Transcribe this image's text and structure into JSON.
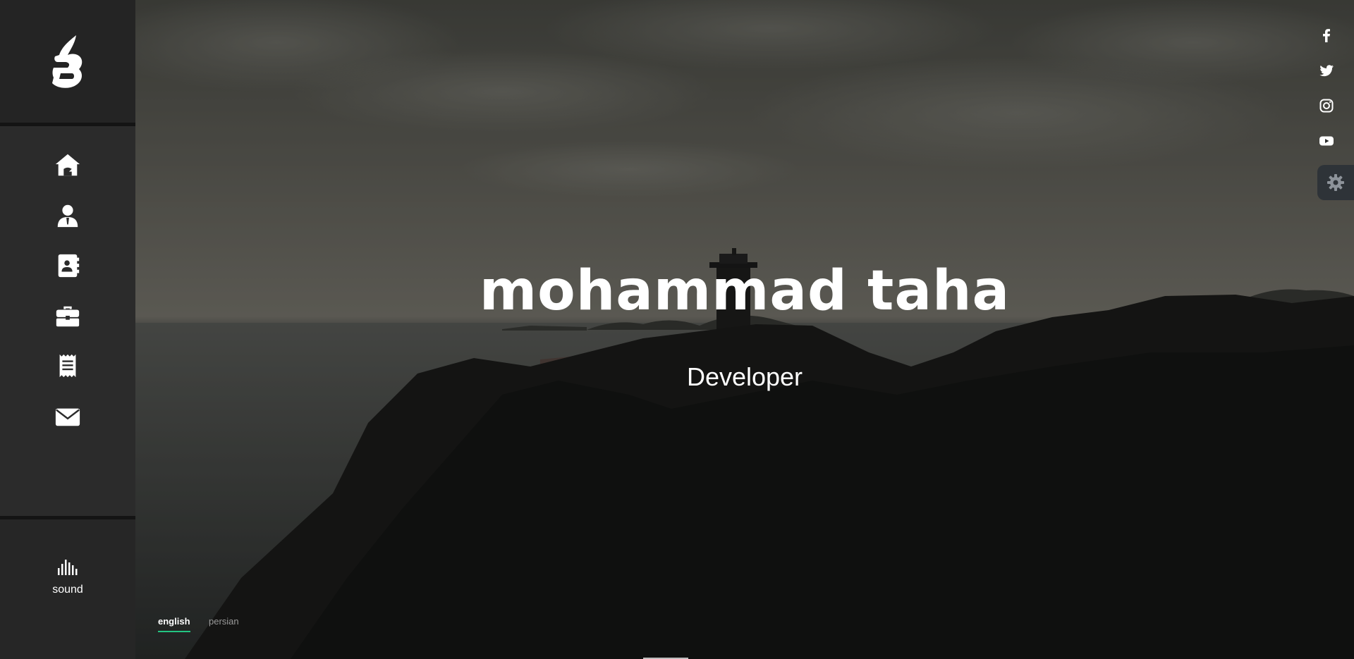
{
  "hero": {
    "name": "mohammad taha",
    "role": "Developer"
  },
  "sidebar": {
    "logo": "logo-icon",
    "items": [
      {
        "icon": "home-icon"
      },
      {
        "icon": "user-icon"
      },
      {
        "icon": "contact-book-icon"
      },
      {
        "icon": "briefcase-icon"
      },
      {
        "icon": "receipt-icon"
      },
      {
        "icon": "envelope-icon"
      }
    ],
    "sound_label": "sound"
  },
  "languages": {
    "english": "english",
    "persian": "persian",
    "active": "english"
  },
  "social": [
    "facebook-icon",
    "twitter-icon",
    "instagram-icon",
    "youtube-icon"
  ],
  "settings": {
    "icon": "gear-icon"
  },
  "colors": {
    "accent": "#23c483",
    "sidebar": "#2b2b2b"
  }
}
